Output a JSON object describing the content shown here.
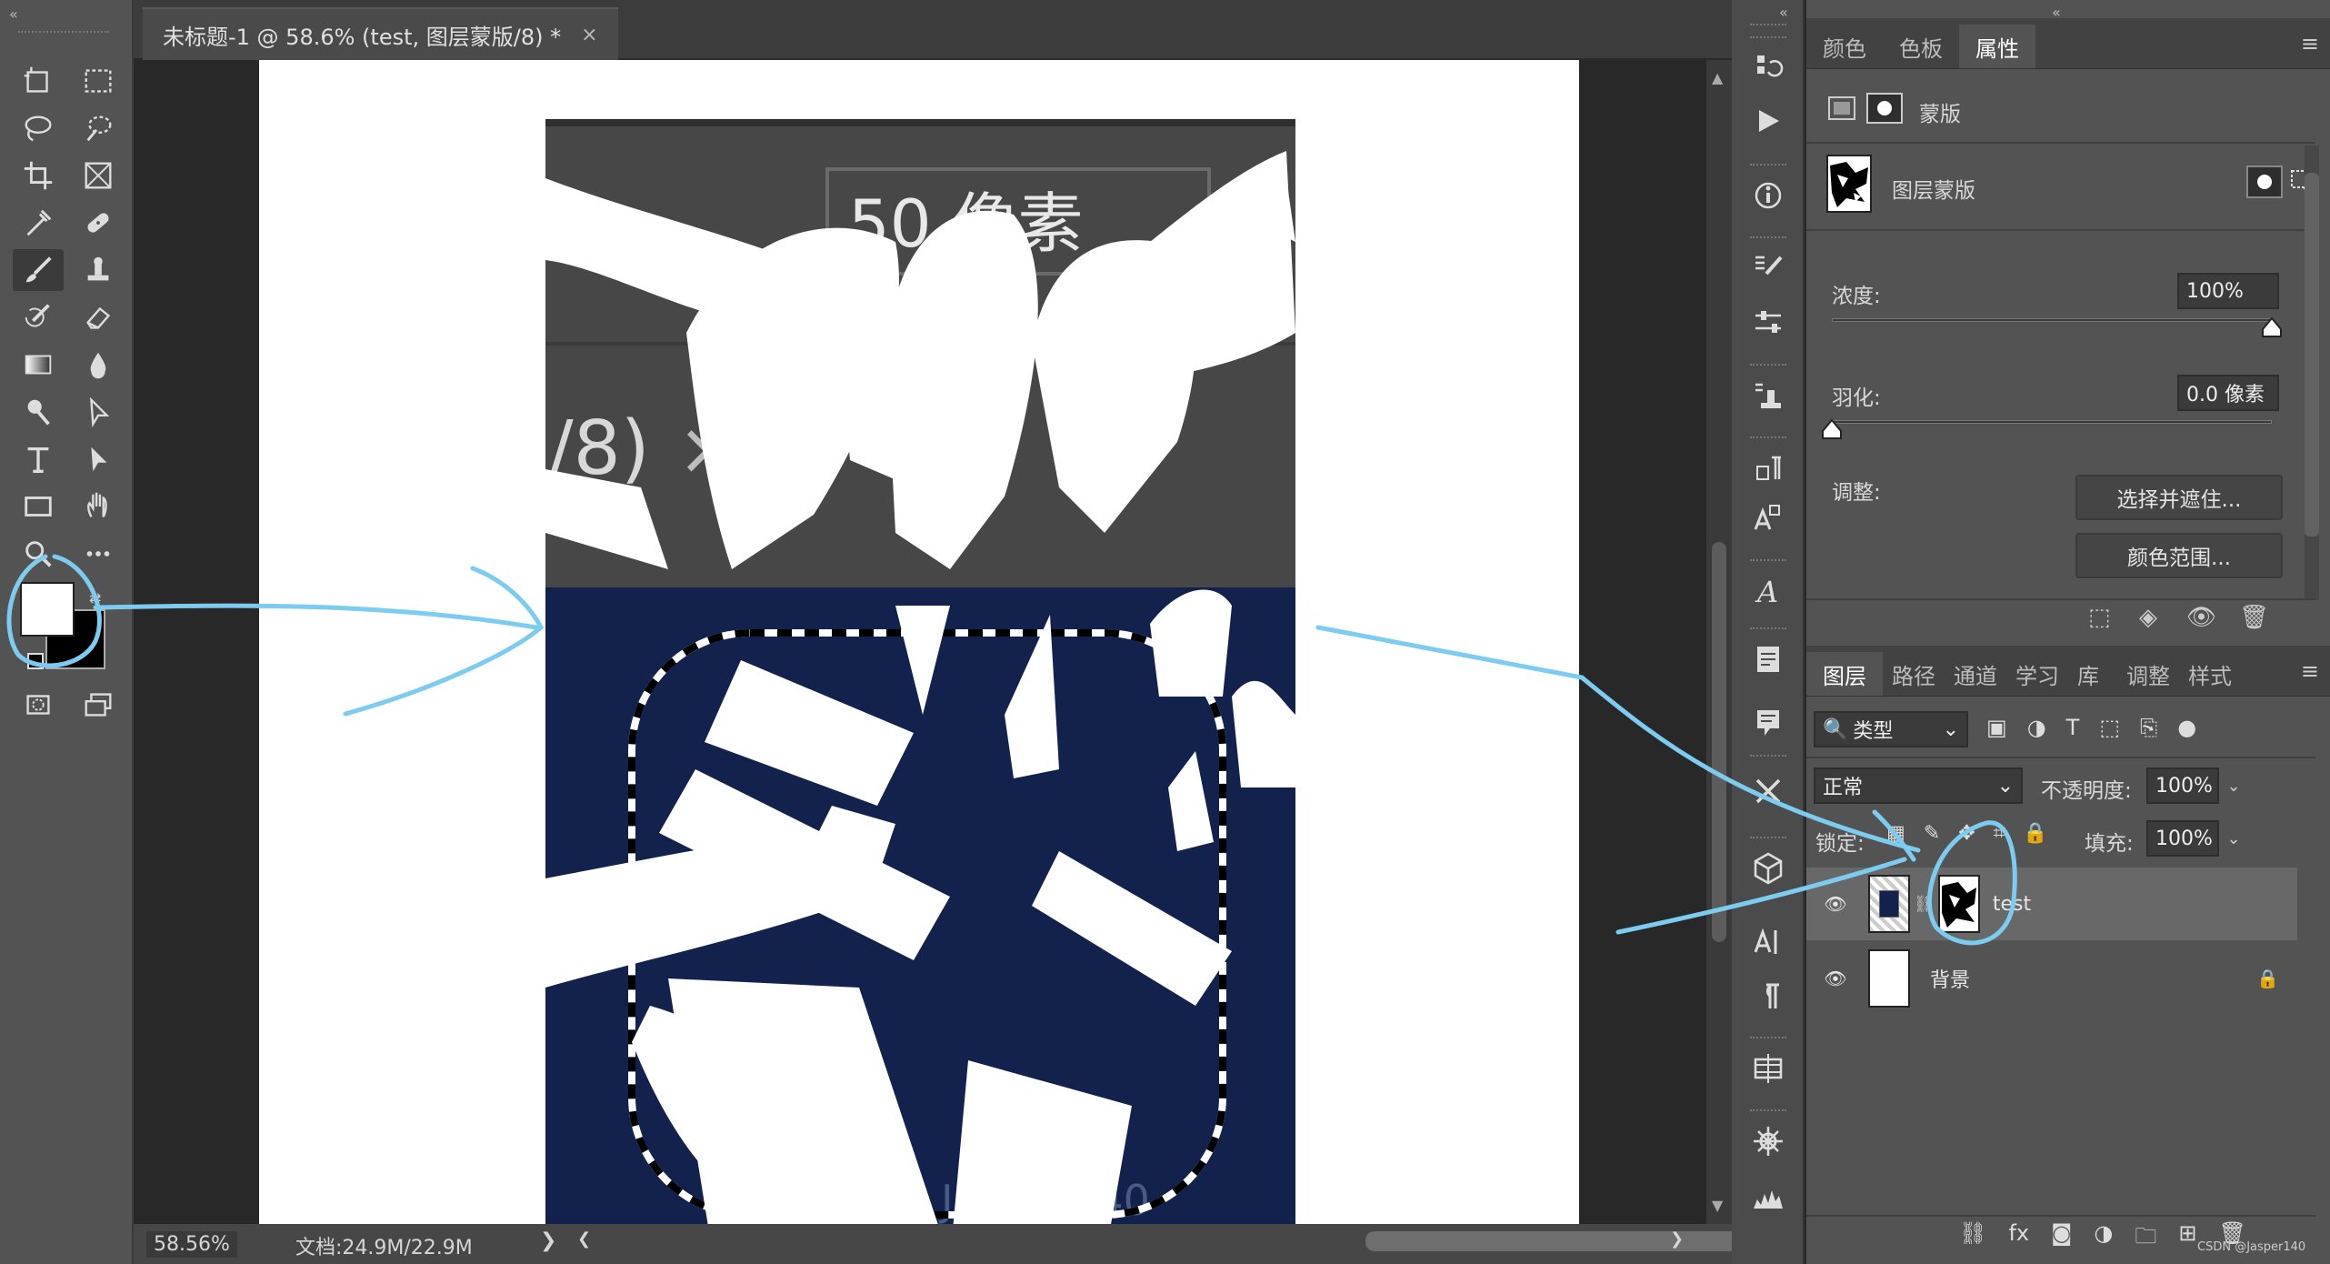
{
  "document": {
    "tab_title": "未标题-1 @ 58.6% (test, 图层蒙版/8) *",
    "tab_close": "×",
    "zoom": "58.56%",
    "doc_info": "文档:24.9M/22.9M",
    "artwork_text": {
      "size_field": "50 像素",
      "tab_fragment": "/8)",
      "close_glyph": "×",
      "watermark": "Jasper140"
    }
  },
  "toolbar": {
    "collapse": "«",
    "tools": [
      "artboard-icon",
      "marquee-icon",
      "lasso-icon",
      "quick-select-icon",
      "crop-icon",
      "frame-icon",
      "eyedropper-icon",
      "healing-brush-icon",
      "brush-icon",
      "clone-stamp-icon",
      "history-brush-icon",
      "eraser-icon",
      "gradient-icon",
      "blur-icon",
      "dodge-icon",
      "path-select-icon",
      "type-icon",
      "direct-select-icon",
      "rectangle-icon",
      "hand-icon",
      "zoom-icon",
      "more-tools-icon"
    ],
    "active_tool": "brush-icon",
    "foreground_color": "#ffffff",
    "background_color": "#000000"
  },
  "strip": {
    "collapse": "«",
    "icons": [
      "history-icon",
      "actions-play-icon",
      "info-icon",
      "brush-settings-icon",
      "adjust-sliders-icon",
      "clone-source-icon",
      "paragraph-styles-icon",
      "character-styles-icon",
      "glyphs-icon",
      "notes-icon",
      "comments-icon",
      "tools-crossed-icon",
      "3d-cube-icon",
      "character-icon",
      "paragraph-icon",
      "timeline-icon",
      "properties-wheel-icon",
      "histogram-icon"
    ]
  },
  "properties_panel": {
    "collapse": "«",
    "tabs": [
      "颜色",
      "色板",
      "属性"
    ],
    "active_tab": "属性",
    "mask_type_label": "蒙版",
    "layer_mask_label": "图层蒙版",
    "density_label": "浓度:",
    "density_value": "100%",
    "density_fraction": 1.0,
    "feather_label": "羽化:",
    "feather_value": "0.0 像素",
    "feather_fraction": 0.0,
    "adjust_label": "调整:",
    "select_and_mask_button": "选择并遮住...",
    "color_range_button": "颜色范围..."
  },
  "layers_panel": {
    "tabs": [
      "图层",
      "路径",
      "通道",
      "学习",
      "库",
      "调整",
      "样式"
    ],
    "active_tab": "图层",
    "filter_kind": "类型",
    "blend_mode": "正常",
    "opacity_label": "不透明度:",
    "opacity_value": "100%",
    "lock_label": "锁定:",
    "fill_label": "填充:",
    "fill_value": "100%",
    "layers": [
      {
        "name": "test",
        "visible": true,
        "selected": true,
        "has_mask": true,
        "locked": false
      },
      {
        "name": "背景",
        "visible": true,
        "selected": false,
        "has_mask": false,
        "locked": true
      }
    ]
  },
  "watermark_corner": "CSDN @Jasper140",
  "colors": {
    "annotation": "#7ccbf0",
    "navy": "#13214d",
    "ui_dark": "#535353"
  }
}
